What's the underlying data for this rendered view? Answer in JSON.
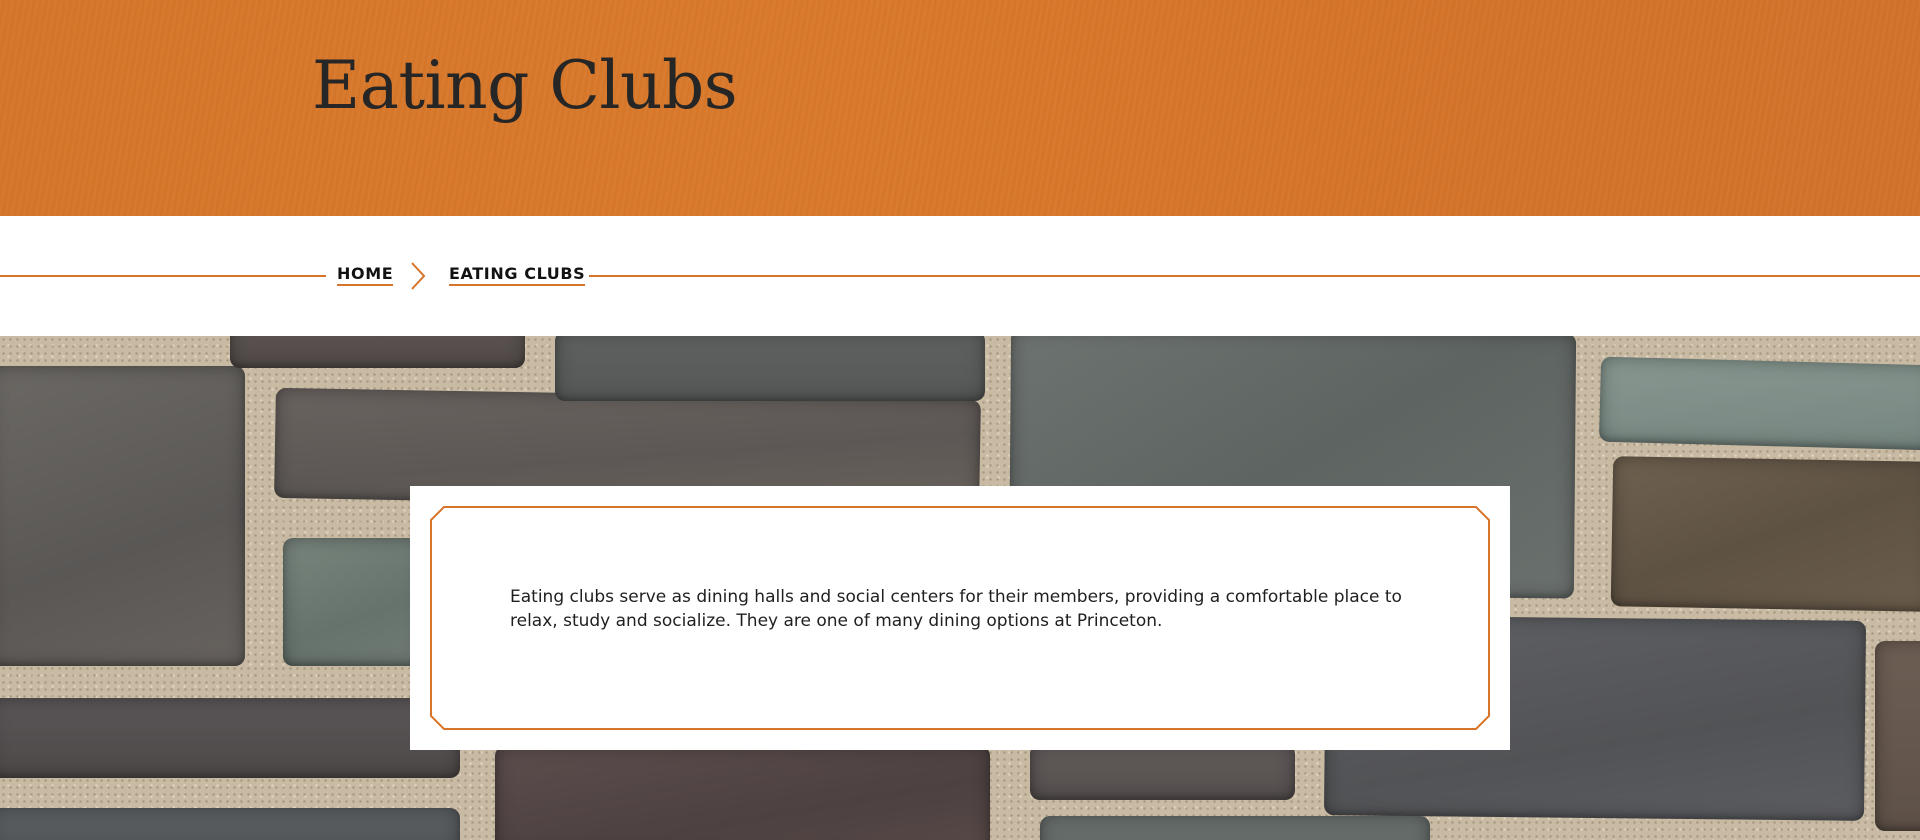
{
  "header": {
    "title": "Eating Clubs"
  },
  "breadcrumb": {
    "items": [
      {
        "label": "HOME"
      },
      {
        "label": "EATING CLUBS"
      }
    ],
    "separator_icon": "chevron-right-icon"
  },
  "hero": {
    "background": "stone-wall-photo"
  },
  "intro": {
    "text": "Eating clubs serve as dining halls and social centers for their members, providing a comfortable place to relax, study and socialize. They are one of many dining options at Princeton."
  },
  "colors": {
    "accent": "#d5742a",
    "text": "#262626",
    "mortar": "#c9bba3"
  }
}
